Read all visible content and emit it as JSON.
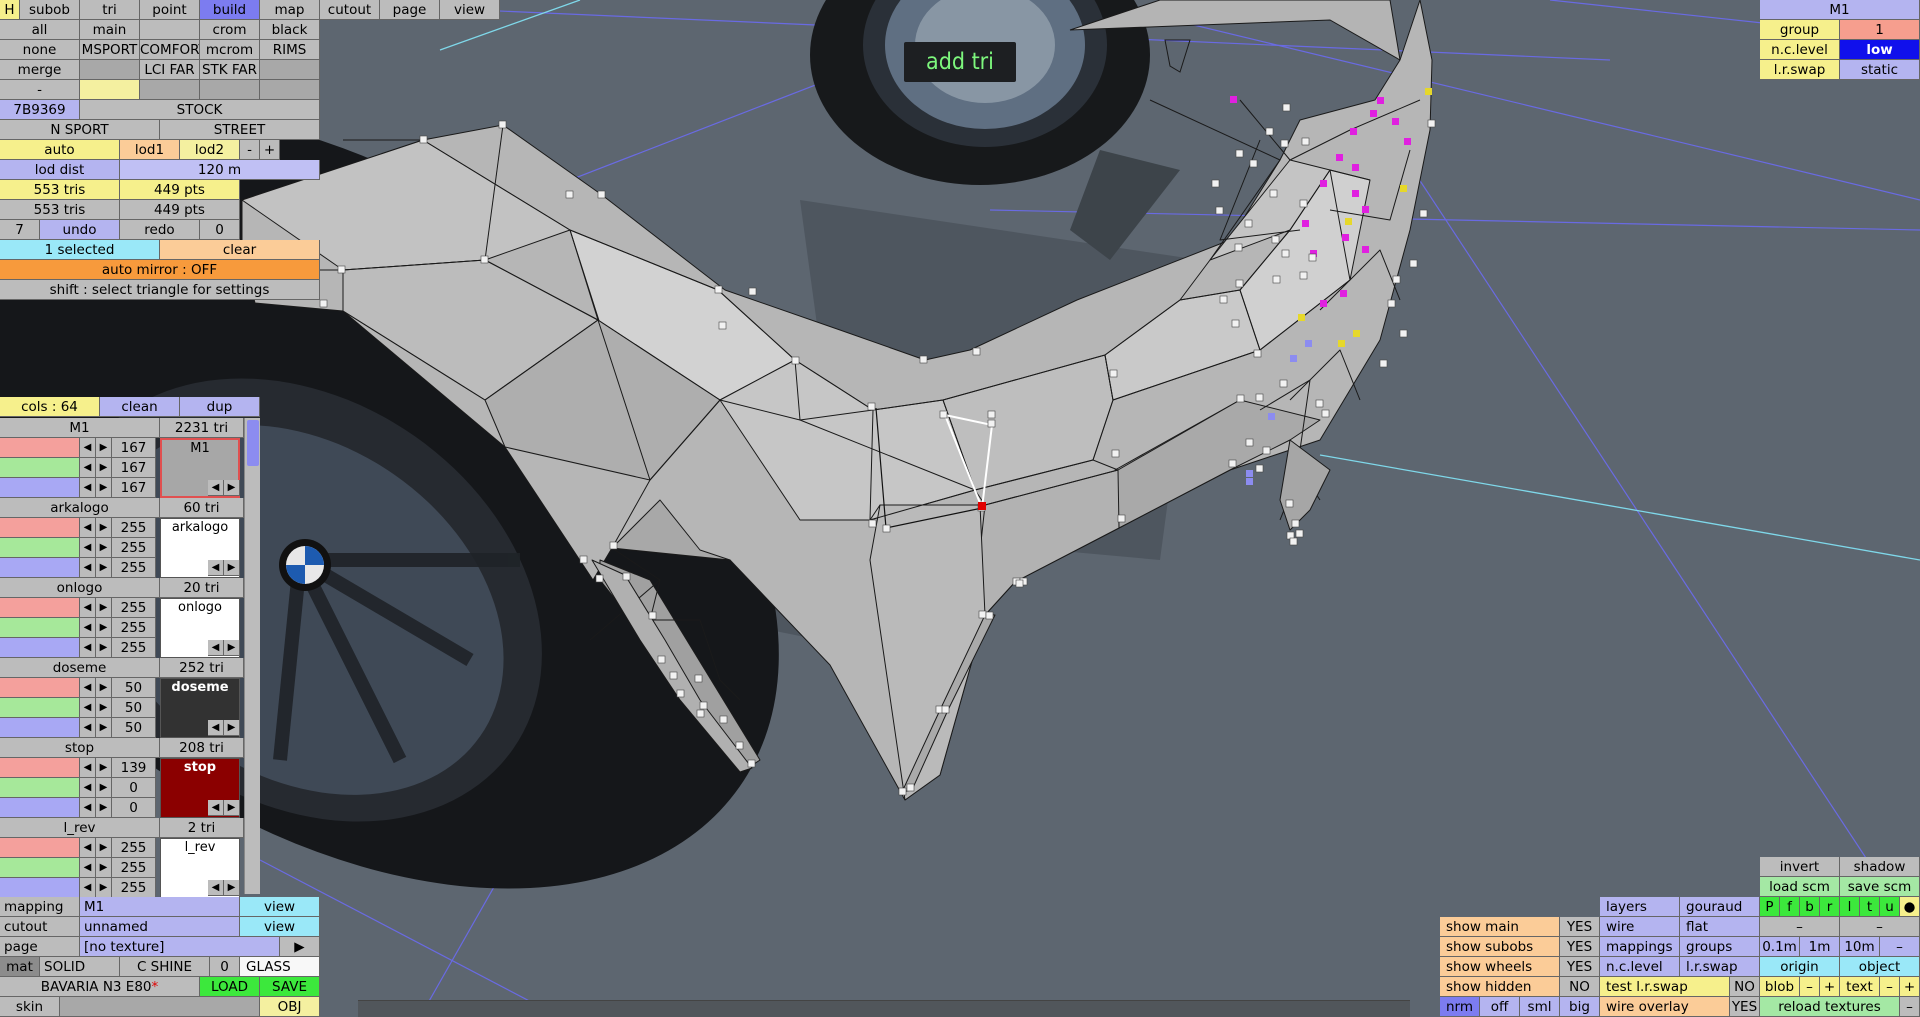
{
  "hint": "add tri",
  "colors": {
    "viewport_bg": "#5d6670",
    "mesh_fill": "#b8b8b8",
    "selected_vertex": "#e00000",
    "wireframe": "#1a1a1a"
  },
  "menu": {
    "row1": [
      "H",
      "subob",
      "tri",
      "point",
      "build",
      "map",
      "cutout",
      "page",
      "view"
    ],
    "row2": [
      "all",
      "main",
      "",
      "crom",
      "black"
    ],
    "row3": [
      "none",
      "MSPORT",
      "COMFORT",
      "mcrom",
      "RIMS"
    ],
    "row4": [
      "merge",
      "",
      "LCI FAR",
      "STK FAR",
      ""
    ],
    "row5": [
      "-",
      "",
      "",
      "",
      ""
    ],
    "row6": [
      "7B9369",
      "STOCK"
    ],
    "row7": [
      "N SPORT",
      "STREET"
    ],
    "row8": [
      "auto",
      "lod1",
      "lod2",
      "-",
      "+"
    ],
    "lod_dist_label": "lod dist",
    "lod_dist_value": "120 m",
    "tris1": "553 tris",
    "pts1": "449 pts",
    "tris2": "553 tris",
    "pts2": "449 pts",
    "undo_count": "7",
    "undo": "undo",
    "redo": "redo",
    "redo_count": "0",
    "selected": "1 selected",
    "clear": "clear",
    "auto_mirror": "auto mirror : OFF",
    "shift_hint": "shift : select triangle for settings"
  },
  "colorlist": {
    "cols_label": "cols : 64",
    "clean": "clean",
    "dup": "dup",
    "arrow_left": "◀",
    "arrow_right": "▶",
    "items": [
      {
        "name": "M1",
        "tris": "2231 tri",
        "r": "167",
        "g": "167",
        "b": "167",
        "swatch_label": "M1",
        "swatch_bg": "#a7a7a7",
        "swatch_fg": "#000000"
      },
      {
        "name": "arkalogo",
        "tris": "60 tri",
        "r": "255",
        "g": "255",
        "b": "255",
        "swatch_label": "arkalogo",
        "swatch_bg": "#ffffff",
        "swatch_fg": "#000000"
      },
      {
        "name": "onlogo",
        "tris": "20 tri",
        "r": "255",
        "g": "255",
        "b": "255",
        "swatch_label": "onlogo",
        "swatch_bg": "#ffffff",
        "swatch_fg": "#000000"
      },
      {
        "name": "doseme",
        "tris": "252 tri",
        "r": "50",
        "g": "50",
        "b": "50",
        "swatch_label": "doseme",
        "swatch_bg": "#323232",
        "swatch_fg": "#ffffff"
      },
      {
        "name": "stop",
        "tris": "208 tri",
        "r": "139",
        "g": "0",
        "b": "0",
        "swatch_label": "stop",
        "swatch_bg": "#8b0000",
        "swatch_fg": "#ffffff"
      },
      {
        "name": "l_rev",
        "tris": "2 tri",
        "r": "255",
        "g": "255",
        "b": "255",
        "swatch_label": "l_rev",
        "swatch_bg": "#ffffff",
        "swatch_fg": "#000000"
      }
    ]
  },
  "bottom_left": {
    "mapping_label": "mapping",
    "mapping_value": "M1",
    "view1": "view",
    "cutout_label": "cutout",
    "cutout_value": "unnamed",
    "view2": "view",
    "page_label": "page",
    "page_value": "[no texture]",
    "page_arrow": "▶",
    "mat_label": "mat",
    "solid": "SOLID",
    "c_shine": "C SHINE",
    "zero": "0",
    "glass": "GLASS",
    "project_name": "BAVARIA N3 E80",
    "modified_mark": "*",
    "load": "LOAD",
    "save": "SAVE",
    "skin_label": "skin",
    "obj": "OBJ"
  },
  "top_right": {
    "title": "M1",
    "group_label": "group",
    "group_value": "1",
    "nc_label": "n.c.level",
    "nc_value": "low",
    "lr_label": "l.r.swap",
    "lr_value": "static"
  },
  "bottom_right": {
    "invert": "invert",
    "shadow": "shadow",
    "load_scm": "load scm",
    "save_scm": "save scm",
    "view_dirs": [
      "P",
      "f",
      "b",
      "r",
      "l",
      "t",
      "u",
      "●"
    ],
    "dash1": "–",
    "dash2": "–",
    "layers": "layers",
    "gouraud": "gouraud",
    "show_main": "show main",
    "show_main_v": "YES",
    "wire": "wire",
    "flat": "flat",
    "show_subobs": "show subobs",
    "show_subobs_v": "YES",
    "mappings": "mappings",
    "groups": "groups",
    "steps": [
      "0.1m",
      "1m",
      "10m",
      "–"
    ],
    "show_wheels": "show wheels",
    "show_wheels_v": "YES",
    "nclevel": "n.c.level",
    "lrswap": "l.r.swap",
    "origin": "origin",
    "object": "object",
    "show_hidden": "show hidden",
    "show_hidden_v": "NO",
    "test_lr": "test l.r.swap",
    "test_lr_v": "NO",
    "blob": "blob",
    "blob_minus": "–",
    "blob_plus": "+",
    "text": "text",
    "text_minus": "–",
    "text_plus": "+",
    "nrm": "nrm",
    "off": "off",
    "sml": "sml",
    "big": "big",
    "wire_overlay": "wire overlay",
    "wire_overlay_v": "YES",
    "reload": "reload textures",
    "reload_dash": "–"
  }
}
